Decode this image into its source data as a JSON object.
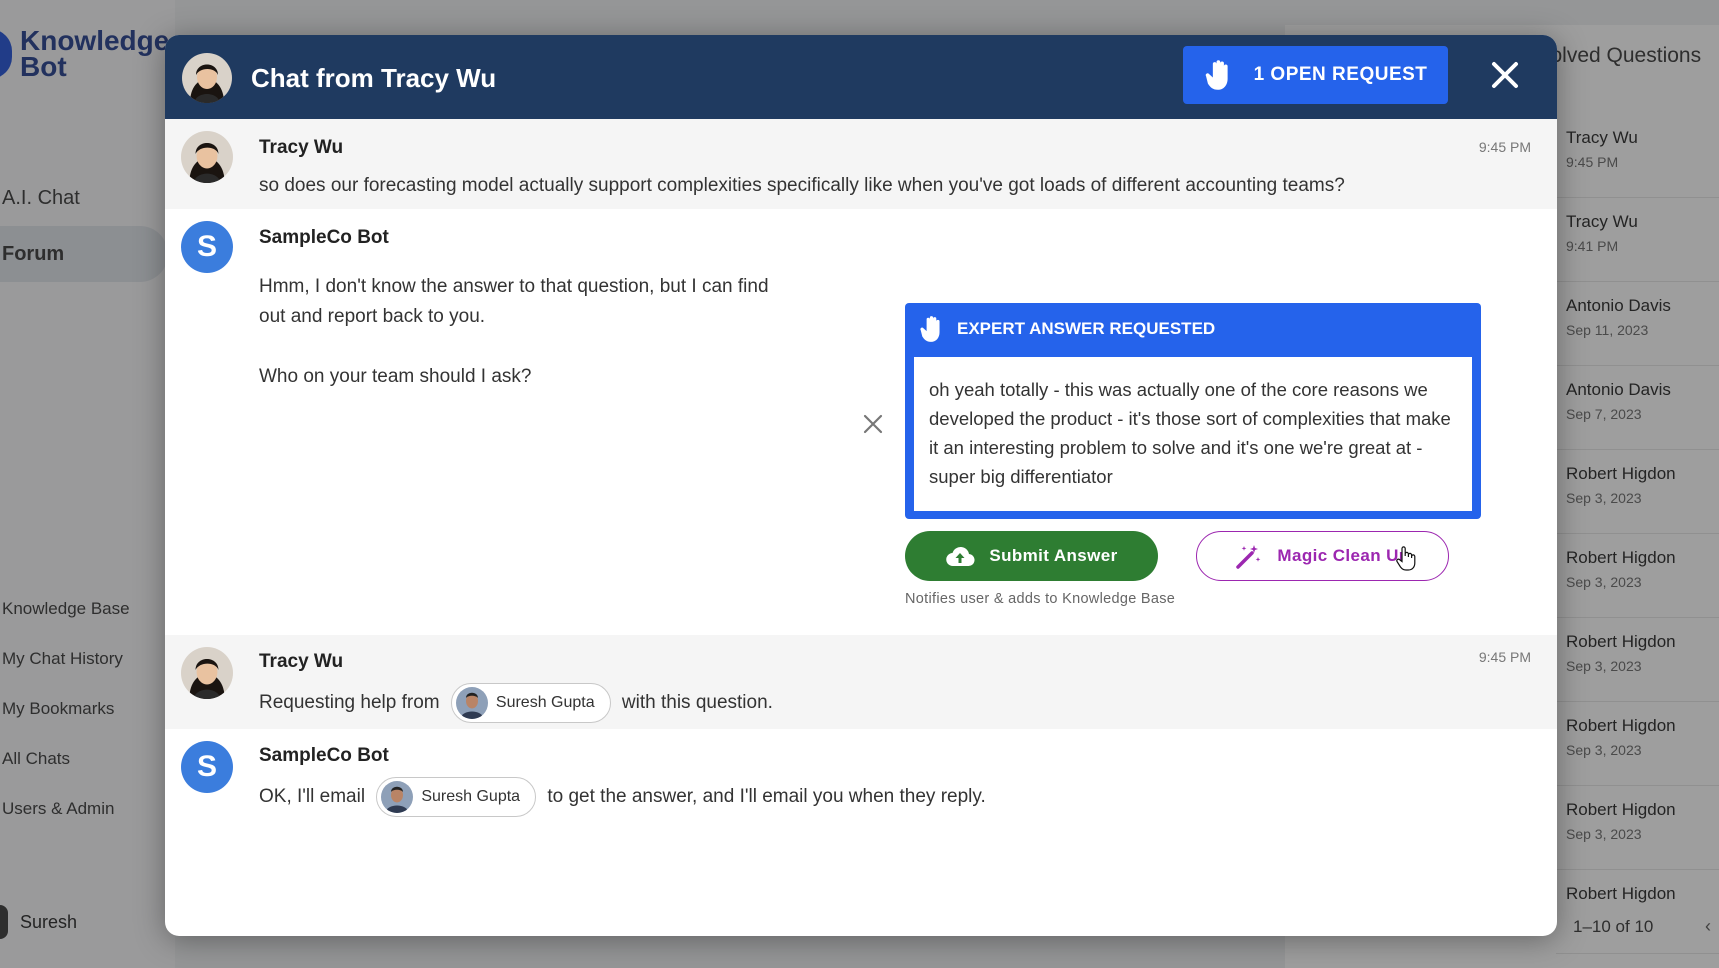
{
  "app": {
    "logo_line1": "Knowledge",
    "logo_line2": "Bot",
    "nav_top": [
      "A.I. Chat",
      "Forum"
    ],
    "nav_bottom": [
      "Knowledge Base",
      "My Chat History",
      "My Bookmarks",
      "All Chats",
      "Users & Admin"
    ],
    "user_name": "Suresh",
    "right_panel_title": "solved Questions",
    "right_list": [
      {
        "name": "Tracy Wu",
        "date": "9:45 PM"
      },
      {
        "name": "Tracy Wu",
        "date": "9:41 PM"
      },
      {
        "name": "Antonio Davis",
        "date": "Sep 11, 2023"
      },
      {
        "name": "Antonio Davis",
        "date": "Sep 7, 2023"
      },
      {
        "name": "Robert Higdon",
        "date": "Sep 3, 2023"
      },
      {
        "name": "Robert Higdon",
        "date": "Sep 3, 2023"
      },
      {
        "name": "Robert Higdon",
        "date": "Sep 3, 2023"
      },
      {
        "name": "Robert Higdon",
        "date": "Sep 3, 2023"
      },
      {
        "name": "Robert Higdon",
        "date": "Sep 3, 2023"
      },
      {
        "name": "Robert Higdon",
        "date": ""
      }
    ],
    "pager": "1–10 of 10"
  },
  "modal": {
    "title": "Chat from Tracy Wu",
    "open_request_label": "1 OPEN REQUEST",
    "messages": [
      {
        "sender": "Tracy Wu",
        "time": "9:45 PM",
        "text": "so does our forecasting model actually support complexities specifically like when you've got loads of different accounting teams?"
      },
      {
        "sender": "SampleCo Bot",
        "avatar_letter": "S",
        "line1": "Hmm, I don't know the answer to that question, but I can find",
        "line2": "out and report back to you.",
        "line3": "Who on your team should I ask?"
      },
      {
        "sender": "Tracy Wu",
        "time": "9:45 PM",
        "text_before": "Requesting help from",
        "chip": "Suresh Gupta",
        "text_after": "with this question."
      },
      {
        "sender": "SampleCo Bot",
        "avatar_letter": "S",
        "text_before": "OK, I'll email",
        "chip": "Suresh Gupta",
        "text_after": "to get the answer, and I'll email you when they reply."
      }
    ],
    "expert": {
      "heading": "EXPERT ANSWER REQUESTED",
      "answer": "oh yeah totally - this was actually one of the core reasons we developed the product - it's those sort of complexities that make it an interesting problem to solve and it's one we're great at - super big differentiator",
      "submit_label": "Submit Answer",
      "magic_label": "Magic Clean Up",
      "notice": "Notifies user & adds to Knowledge Base"
    }
  },
  "colors": {
    "header_bg": "#1f3a60",
    "accent_blue": "#2563eb",
    "submit_green": "#2e7d32",
    "magic_purple": "#9c27b0"
  }
}
